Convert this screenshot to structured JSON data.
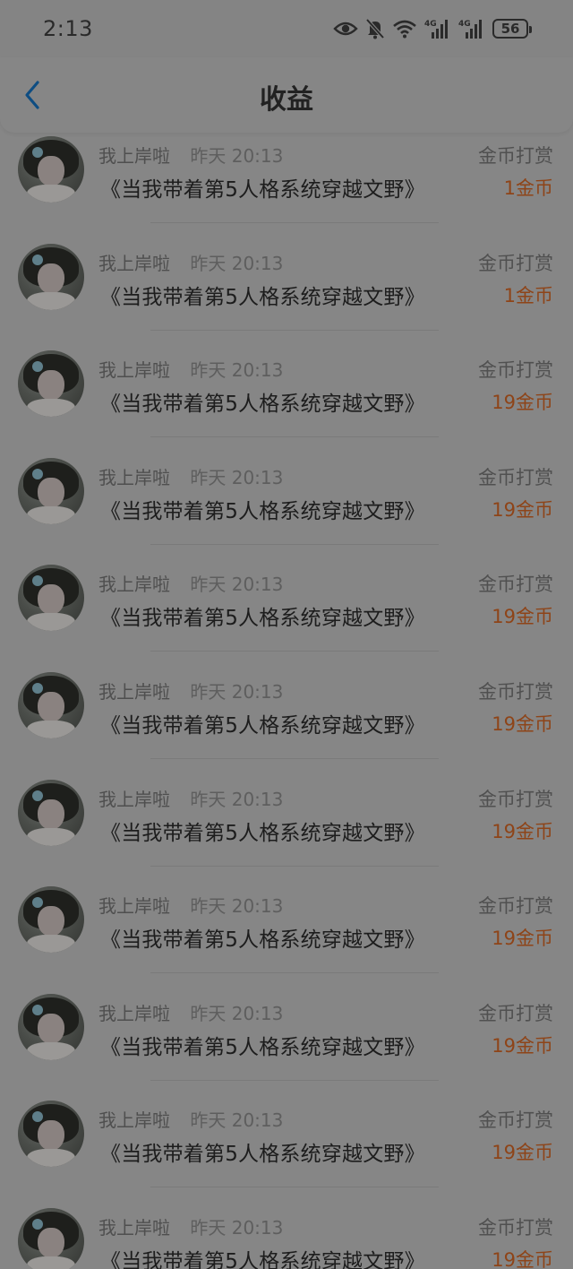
{
  "status_bar": {
    "time": "2:13",
    "battery": "56",
    "icons": [
      "eye-icon",
      "bell-muted-icon",
      "wifi-icon",
      "signal-4g-icon",
      "signal-4g-icon"
    ]
  },
  "header": {
    "title": "收益",
    "back_icon": "chevron-left-icon"
  },
  "colors": {
    "accent_amount": "#8e4418",
    "back_arrow": "#0e4d82"
  },
  "rewards": [
    {
      "sender": "我上岸啦",
      "time": "昨天 20:13",
      "book": "《当我带着第5人格系统穿越文野》",
      "type": "金币打赏",
      "amount": "1金币"
    },
    {
      "sender": "我上岸啦",
      "time": "昨天 20:13",
      "book": "《当我带着第5人格系统穿越文野》",
      "type": "金币打赏",
      "amount": "1金币"
    },
    {
      "sender": "我上岸啦",
      "time": "昨天 20:13",
      "book": "《当我带着第5人格系统穿越文野》",
      "type": "金币打赏",
      "amount": "19金币"
    },
    {
      "sender": "我上岸啦",
      "time": "昨天 20:13",
      "book": "《当我带着第5人格系统穿越文野》",
      "type": "金币打赏",
      "amount": "19金币"
    },
    {
      "sender": "我上岸啦",
      "time": "昨天 20:13",
      "book": "《当我带着第5人格系统穿越文野》",
      "type": "金币打赏",
      "amount": "19金币"
    },
    {
      "sender": "我上岸啦",
      "time": "昨天 20:13",
      "book": "《当我带着第5人格系统穿越文野》",
      "type": "金币打赏",
      "amount": "19金币"
    },
    {
      "sender": "我上岸啦",
      "time": "昨天 20:13",
      "book": "《当我带着第5人格系统穿越文野》",
      "type": "金币打赏",
      "amount": "19金币"
    },
    {
      "sender": "我上岸啦",
      "time": "昨天 20:13",
      "book": "《当我带着第5人格系统穿越文野》",
      "type": "金币打赏",
      "amount": "19金币"
    },
    {
      "sender": "我上岸啦",
      "time": "昨天 20:13",
      "book": "《当我带着第5人格系统穿越文野》",
      "type": "金币打赏",
      "amount": "19金币"
    },
    {
      "sender": "我上岸啦",
      "time": "昨天 20:13",
      "book": "《当我带着第5人格系统穿越文野》",
      "type": "金币打赏",
      "amount": "19金币"
    },
    {
      "sender": "我上岸啦",
      "time": "昨天 20:13",
      "book": "《当我带着第5人格系统穿越文野》",
      "type": "金币打赏",
      "amount": "19金币"
    }
  ]
}
